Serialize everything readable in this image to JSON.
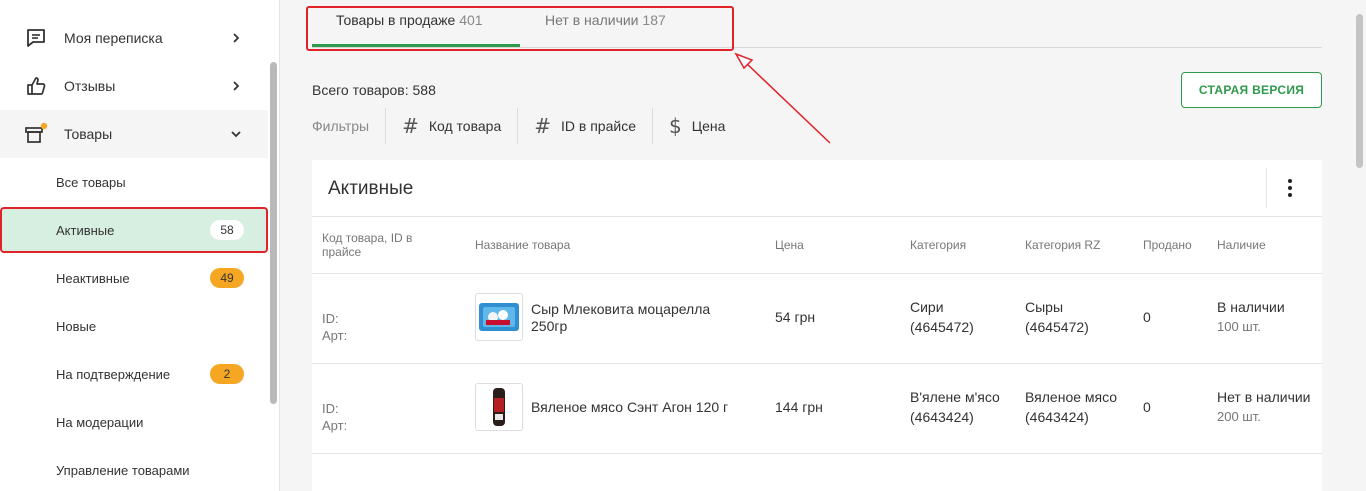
{
  "sidebar": {
    "items": [
      {
        "label": "Моя переписка",
        "icon": "chat-icon"
      },
      {
        "label": "Отзывы",
        "icon": "thumbs-up-icon"
      },
      {
        "label": "Товары",
        "icon": "box-icon"
      }
    ],
    "subitems": [
      {
        "label": "Все товары"
      },
      {
        "label": "Активные",
        "badge": "58"
      },
      {
        "label": "Неактивные",
        "badge": "49"
      },
      {
        "label": "Новые"
      },
      {
        "label": "На подтверждение",
        "badge": "2"
      },
      {
        "label": "На модерации"
      },
      {
        "label": "Управление товарами"
      }
    ]
  },
  "tabs": [
    {
      "label": "Товары в продаже",
      "count": "401"
    },
    {
      "label": "Нет в наличии",
      "count": "187"
    }
  ],
  "total": "Всего товаров: 588",
  "filters": {
    "label": "Фильтры",
    "buttons": [
      {
        "label": "Код товара",
        "icon": "hash-icon"
      },
      {
        "label": "ID в прайсе",
        "icon": "hash-icon"
      },
      {
        "label": "Цена",
        "icon": "dollar-icon"
      }
    ]
  },
  "old_version_label": "СТАРАЯ ВЕРСИЯ",
  "card": {
    "title": "Активные",
    "columns": [
      "Код товара, ID в прайсе",
      "Название товара",
      "Цена",
      "Категория",
      "Категория RZ",
      "Продано",
      "Наличие"
    ],
    "rows": [
      {
        "id": "ID:",
        "art": "Арт:",
        "name": "Сыр Млековита моцарелла 250гр",
        "price": "54 грн",
        "category": "Сири",
        "category_code": "(4645472)",
        "rz": "Сыры",
        "rz_code": "(4645472)",
        "sold": "0",
        "stock": "В наличии",
        "stock_qty": "100 шт."
      },
      {
        "id": "ID:",
        "art": "Арт:",
        "name": "Вяленое мясо Сэнт Агон 120 г",
        "price": "144 грн",
        "category": "В'ялене м'ясо",
        "category_code": "(4643424)",
        "rz": "Вяленое мясо",
        "rz_code": "(4643424)",
        "sold": "0",
        "stock": "Нет в наличии",
        "stock_qty": "200 шт."
      }
    ]
  },
  "colors": {
    "accent": "#2e9a4b",
    "highlight": "#e0232b",
    "badge": "#f5a623"
  }
}
